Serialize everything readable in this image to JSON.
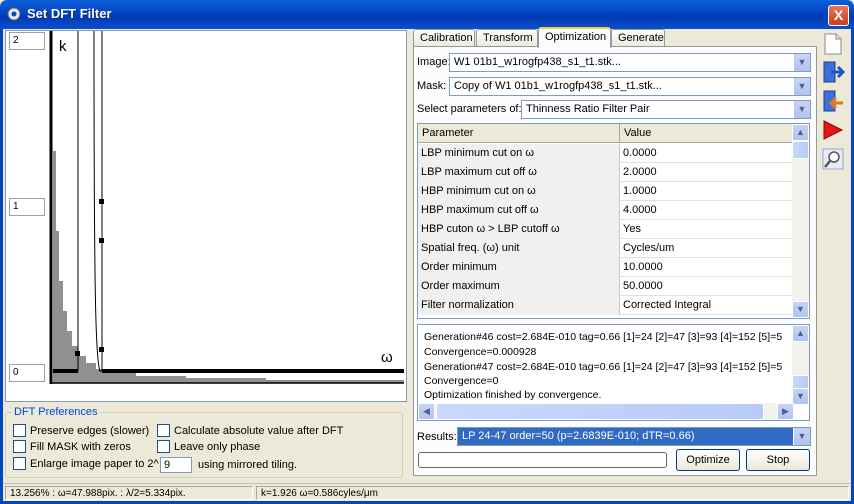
{
  "window": {
    "title": "Set DFT Filter",
    "close_label": "X"
  },
  "plot": {
    "y_labels": [
      "2",
      "1",
      "0"
    ],
    "curve_label": "k",
    "axis_label": "ω"
  },
  "preferences": {
    "legend": "DFT Preferences",
    "preserve_edges": "Preserve edges (slower)",
    "calc_abs": "Calculate absolute value after DFT",
    "fill_mask": "Fill MASK with zeros",
    "leave_phase": "Leave only phase",
    "enlarge": "Enlarge image paper to 2^",
    "enlarge_value": "9",
    "mirrored": "using mirrored tiling."
  },
  "status": {
    "zoom": "13.256% : ω=47.988pix. : λ/2=5.334pix.",
    "k": "k=1.926 ω=0.586cyles/μm"
  },
  "tabs": [
    "Calibration",
    "Transform",
    "Optimization",
    "Generate"
  ],
  "form": {
    "image_label": "Image:",
    "image_value": "W1 01b1_w1rogfp438_s1_t1.stk...",
    "mask_label": "Mask:",
    "mask_value": "Copy of W1 01b1_w1rogfp438_s1_t1.stk...",
    "select_label": "Select parameters of:",
    "select_value": "Thinness Ratio Filter Pair"
  },
  "grid": {
    "headers": [
      "Parameter",
      "Value"
    ],
    "rows": [
      {
        "p": "LBP minimum cut on ω",
        "v": "0.0000"
      },
      {
        "p": "LBP maximum cut off ω",
        "v": "2.0000"
      },
      {
        "p": "HBP minimum cut on ω",
        "v": "1.0000"
      },
      {
        "p": "HBP maximum cut off ω",
        "v": "4.0000"
      },
      {
        "p": "HBP cuton ω > LBP cutoff ω",
        "v": "Yes"
      },
      {
        "p": "Spatial freq. (ω) unit",
        "v": "Cycles/um"
      },
      {
        "p": "Order minimum",
        "v": "10.0000"
      },
      {
        "p": "Order maximum",
        "v": "50.0000"
      },
      {
        "p": "Filter normalization",
        "v": "Corrected Integral"
      }
    ]
  },
  "log": [
    "Generation#46 cost=2.684E-010 tag=0.66 [1]=24 [2]=47 [3]=93 [4]=152 [5]=5",
    "Convergence=0.000928",
    "Generation#47 cost=2.684E-010 tag=0.66 [1]=24 [2]=47 [3]=93 [4]=152 [5]=5",
    "Convergence=0",
    "Optimization finished by convergence."
  ],
  "results": {
    "label": "Results:",
    "value": "LP  24-47 order=50 (p=2.6839E-010; dTR=0.66)"
  },
  "buttons": {
    "optimize": "Optimize",
    "stop": "Stop"
  },
  "icons": {
    "title": "gear-icon",
    "tools": [
      "new-document-icon",
      "import-icon",
      "export-icon",
      "run-icon",
      "zoom-icon"
    ]
  }
}
